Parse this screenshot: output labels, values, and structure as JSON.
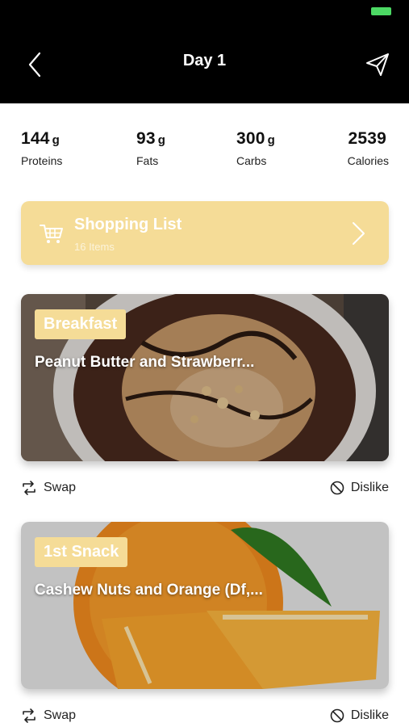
{
  "header": {
    "title": "Day 1"
  },
  "macros": [
    {
      "value": "144",
      "unit": "g",
      "label": "Proteins"
    },
    {
      "value": "93",
      "unit": "g",
      "label": "Fats"
    },
    {
      "value": "300",
      "unit": "g",
      "label": "Carbs"
    },
    {
      "value": "2539",
      "unit": "",
      "label": "Calories"
    }
  ],
  "shopping": {
    "title": "Shopping List",
    "subtitle": "16 Items"
  },
  "meals": [
    {
      "tag": "Breakfast",
      "name": "Peanut Butter and Strawberr...",
      "swap_label": "Swap",
      "dislike_label": "Dislike"
    },
    {
      "tag": "1st Snack",
      "name": "Cashew Nuts and Orange (Df,...",
      "swap_label": "Swap",
      "dislike_label": "Dislike"
    }
  ],
  "colors": {
    "accent": "#f5dc97",
    "header_bg": "#000000",
    "status_green": "#4cd964"
  },
  "icons": [
    "back-arrow-icon",
    "send-icon",
    "cart-icon",
    "chevron-right-icon",
    "swap-icon",
    "dislike-icon"
  ]
}
